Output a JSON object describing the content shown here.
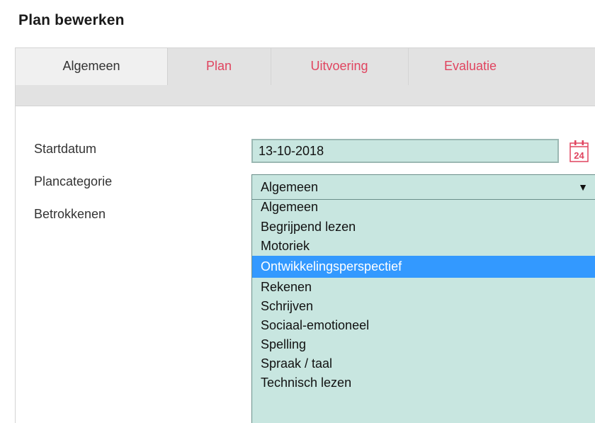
{
  "page": {
    "title": "Plan bewerken"
  },
  "tabs": [
    {
      "label": "Algemeen",
      "active": true
    },
    {
      "label": "Plan",
      "active": false
    },
    {
      "label": "Uitvoering",
      "active": false
    },
    {
      "label": "Evaluatie",
      "active": false
    }
  ],
  "form": {
    "startdatum_label": "Startdatum",
    "startdatum_value": "13-10-2018",
    "calendar_icon_text": "24",
    "plancategorie_label": "Plancategorie",
    "plancategorie_value": "Algemeen",
    "betrokkenen_label": "Betrokkenen"
  },
  "dropdown": {
    "options": [
      "Algemeen",
      "Begrijpend lezen",
      "Motoriek",
      "Ontwikkelingsperspectief",
      "Rekenen",
      "Schrijven",
      "Sociaal-emotioneel",
      "Spelling",
      "Spraak / taal",
      "Technisch lezen"
    ],
    "highlighted": "Ontwikkelingsperspectief"
  },
  "colors": {
    "field_bg": "#c8e6e0",
    "tab_inactive_text": "#e0445f",
    "highlight": "#3399ff",
    "icon_accent": "#e0445f"
  }
}
